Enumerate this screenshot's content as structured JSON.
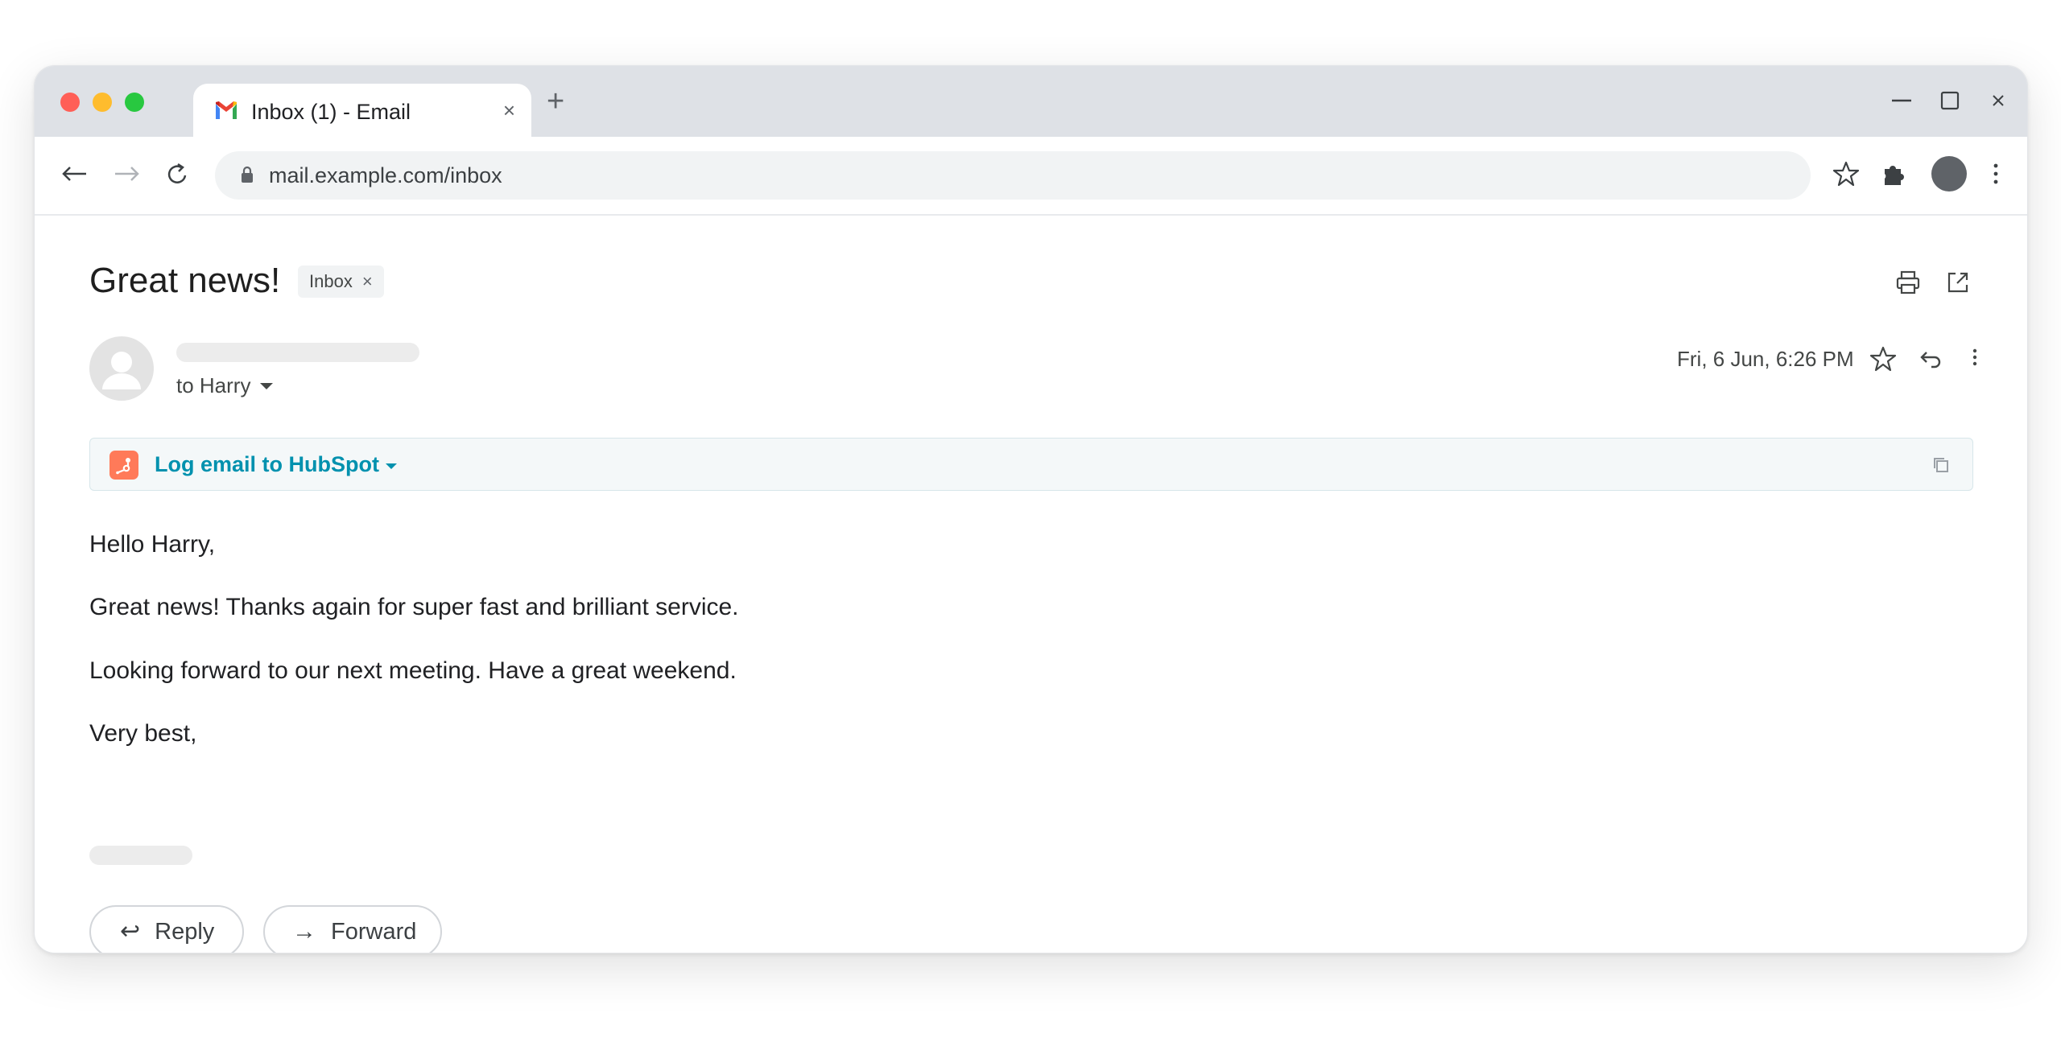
{
  "browser": {
    "tab": {
      "title": "Inbox (1) - Email",
      "close_glyph": "×",
      "favicon": "gmail-icon"
    },
    "new_tab_glyph": "+",
    "window_controls": {
      "minimize": "minimize-icon",
      "maximize": "maximize-icon",
      "close_glyph": "×"
    },
    "nav": {
      "back_glyph": "⟵",
      "forward_glyph": "⟶",
      "reload_glyph": "↻"
    },
    "address_bar": {
      "url": "mail.example.com/inbox"
    },
    "toolbar_icons": [
      "star-icon",
      "extensions-icon",
      "profile-avatar",
      "kebab-menu-icon"
    ]
  },
  "email": {
    "subject": "Great news!",
    "label": {
      "text": "Inbox",
      "remove_glyph": "×"
    },
    "recipient_line": "to Harry",
    "date": "Fri, 6 Jun, 6:26 PM",
    "hubspot": {
      "label": "Log email to HubSpot"
    },
    "body": [
      "Hello Harry,",
      "Great news! Thanks again for super fast and brilliant service.",
      "Looking forward to our next meeting. Have a great weekend.",
      "Very best,"
    ],
    "actions": {
      "reply": {
        "glyph": "↩",
        "label": "Reply"
      },
      "forward": {
        "glyph": "→",
        "label": "Forward"
      }
    }
  },
  "colors": {
    "tabstrip": "#dee1e6",
    "hubspot_orange": "#ff7a59",
    "hubspot_teal": "#0091ae",
    "traffic_red": "#ff5f57",
    "traffic_yellow": "#febc2e",
    "traffic_green": "#28c840"
  }
}
